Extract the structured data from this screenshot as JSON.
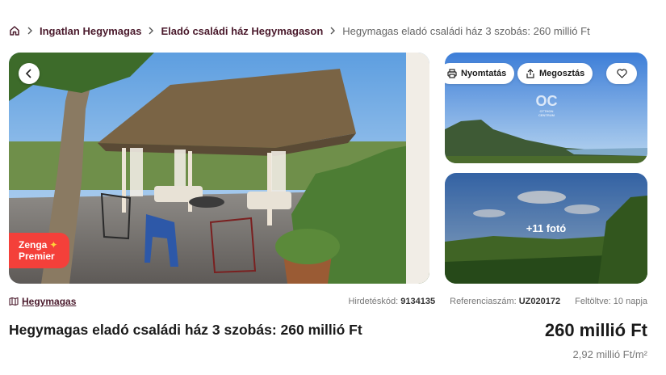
{
  "breadcrumb": {
    "items": [
      "Ingatlan Hegymagas",
      "Eladó családi ház Hegymagason"
    ],
    "current": "Hegymagas eladó családi ház 3 szobás: 260 millió Ft"
  },
  "gallery": {
    "badge_line1": "Zenga",
    "badge_line2": "Premier",
    "print_label": "Nyomtatás",
    "share_label": "Megosztás",
    "more_photos_label": "+11 fotó",
    "watermark_text": "OTTHON CENTRUM"
  },
  "meta": {
    "location": "Hegymagas",
    "ad_code_label": "Hirdetéskód:",
    "ad_code_value": "9134135",
    "ref_label": "Referenciaszám:",
    "ref_value": "UZ020172",
    "uploaded": "Feltöltve: 10 napja"
  },
  "listing": {
    "title": "Hegymagas eladó családi ház 3 szobás: 260 millió Ft",
    "price": "260 millió Ft",
    "price_per_sqm": "2,92 millió Ft/m²"
  },
  "colors": {
    "brand": "#4a1a2c",
    "badge": "#f4403a"
  }
}
